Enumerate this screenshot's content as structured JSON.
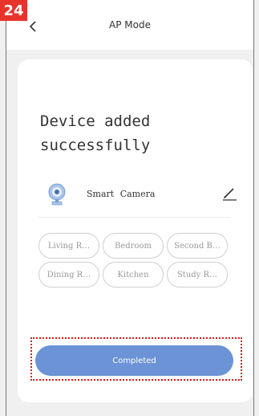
{
  "step_badge": "24",
  "header": {
    "title": "AP Mode"
  },
  "success_message": "Device added successfully",
  "device": {
    "name": "Smart Camera",
    "icon": "camera-icon"
  },
  "rooms": [
    {
      "label": "Living R…"
    },
    {
      "label": "Bedroom"
    },
    {
      "label": "Second B…"
    },
    {
      "label": "Dining R…"
    },
    {
      "label": "Kitchen"
    },
    {
      "label": "Study R…"
    }
  ],
  "actions": {
    "completed_label": "Completed"
  },
  "colors": {
    "accent": "#6b93d6",
    "highlight": "#d9191c",
    "badge": "#e8332a"
  }
}
